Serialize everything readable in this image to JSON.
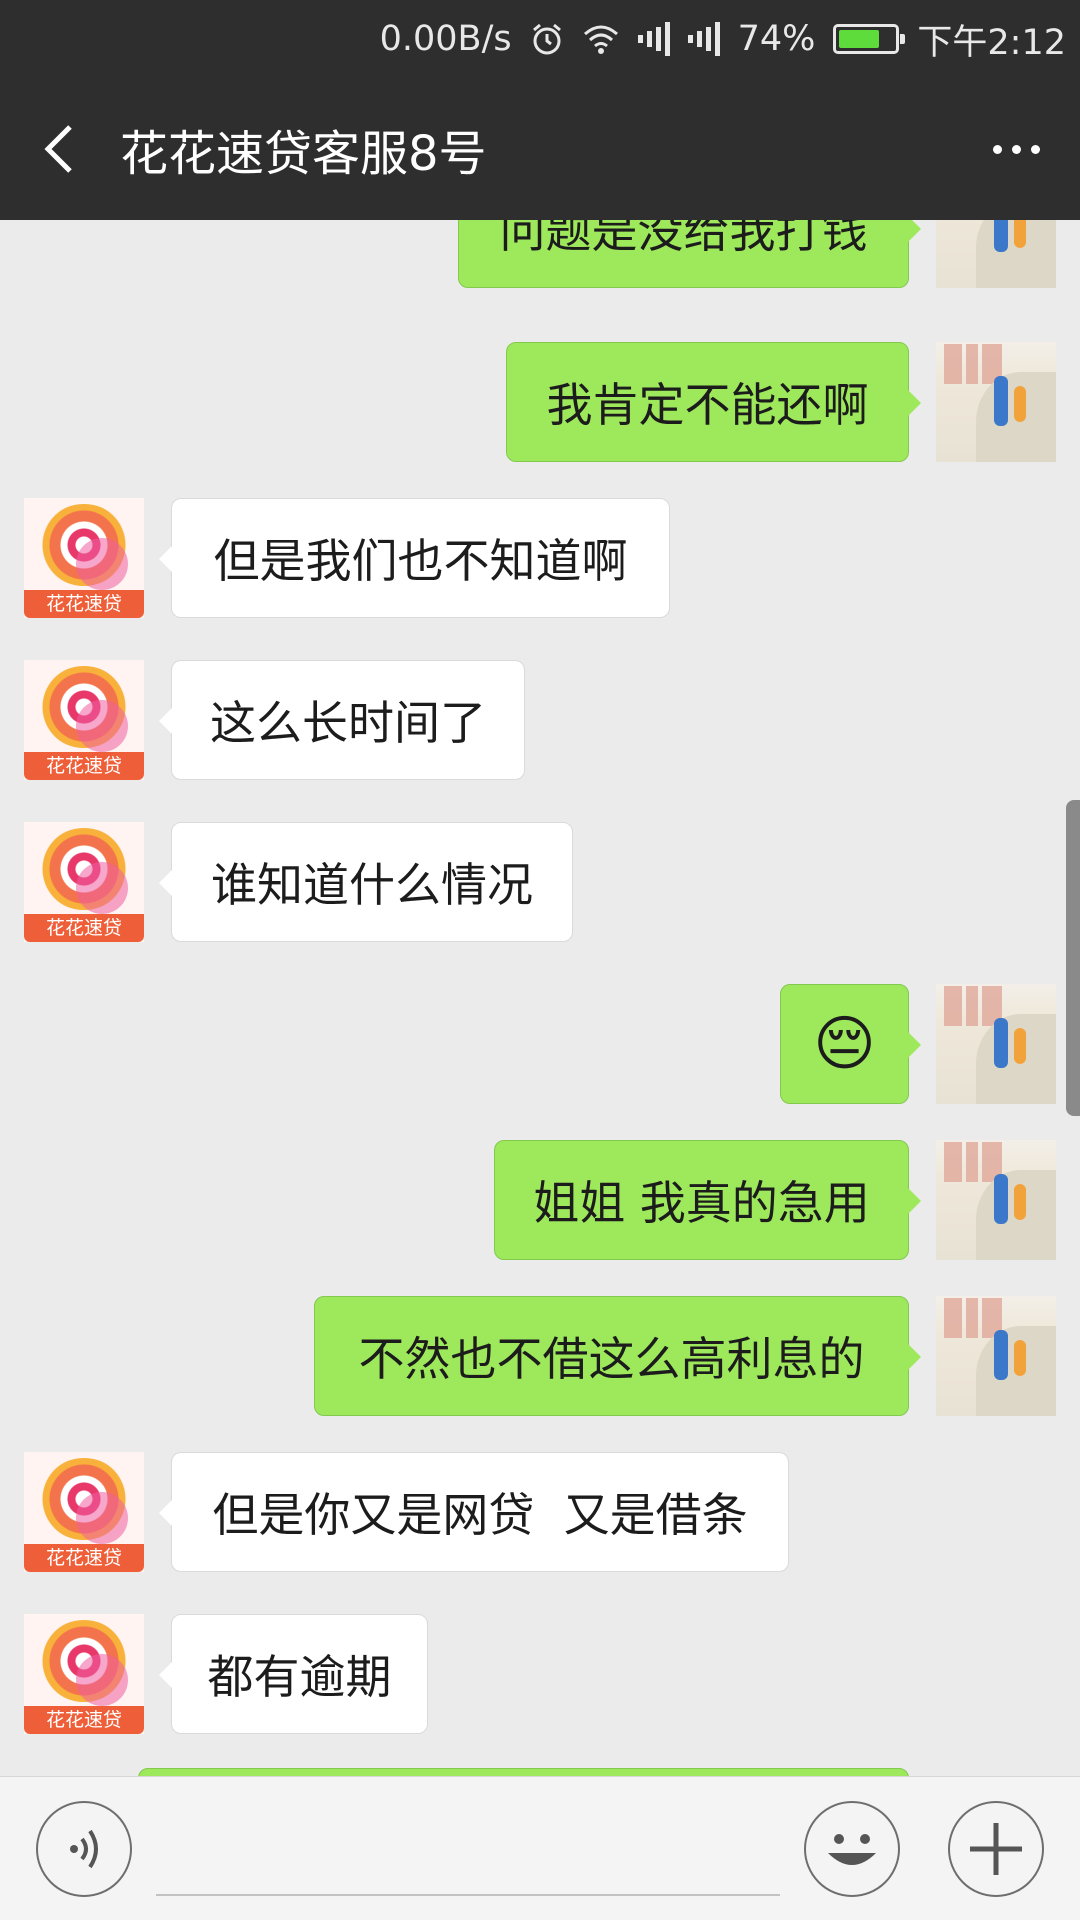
{
  "status_bar": {
    "net_speed": "0.00B/s",
    "battery_percent": "74%",
    "battery_level": 0.74,
    "time": "下午2:12",
    "icons": [
      "alarm-icon",
      "wifi-icon",
      "signal-icon",
      "signal-icon",
      "battery-icon"
    ]
  },
  "header": {
    "title": "花花速贷客服8号",
    "back_icon": "chevron-left-icon",
    "more_icon": "more-icon"
  },
  "brand_avatar_label": "花花速贷",
  "messages": [
    {
      "from": "me",
      "text": "问题是没给我打钱"
    },
    {
      "from": "me",
      "text": "我肯定不能还啊"
    },
    {
      "from": "them",
      "text": "但是我们也不知道啊"
    },
    {
      "from": "them",
      "text": "这么长时间了"
    },
    {
      "from": "them",
      "text": "谁知道什么情况"
    },
    {
      "from": "me",
      "text": "😔"
    },
    {
      "from": "me",
      "text": "姐姐 我真的急用"
    },
    {
      "from": "me",
      "text": "不然也不借这么高利息的"
    },
    {
      "from": "them",
      "text": "但是你又是网贷  又是借条"
    },
    {
      "from": "them",
      "text": "都有逾期"
    }
  ],
  "input_bar": {
    "voice_icon": "voice-icon",
    "emoji_icon": "emoji-icon",
    "plus_icon": "plus-icon"
  },
  "colors": {
    "header_bg": "#2e2e2e",
    "chat_bg": "#ebebeb",
    "my_bubble": "#9ee85c",
    "their_bubble": "#ffffff",
    "brand_orange": "#ee5f39"
  }
}
